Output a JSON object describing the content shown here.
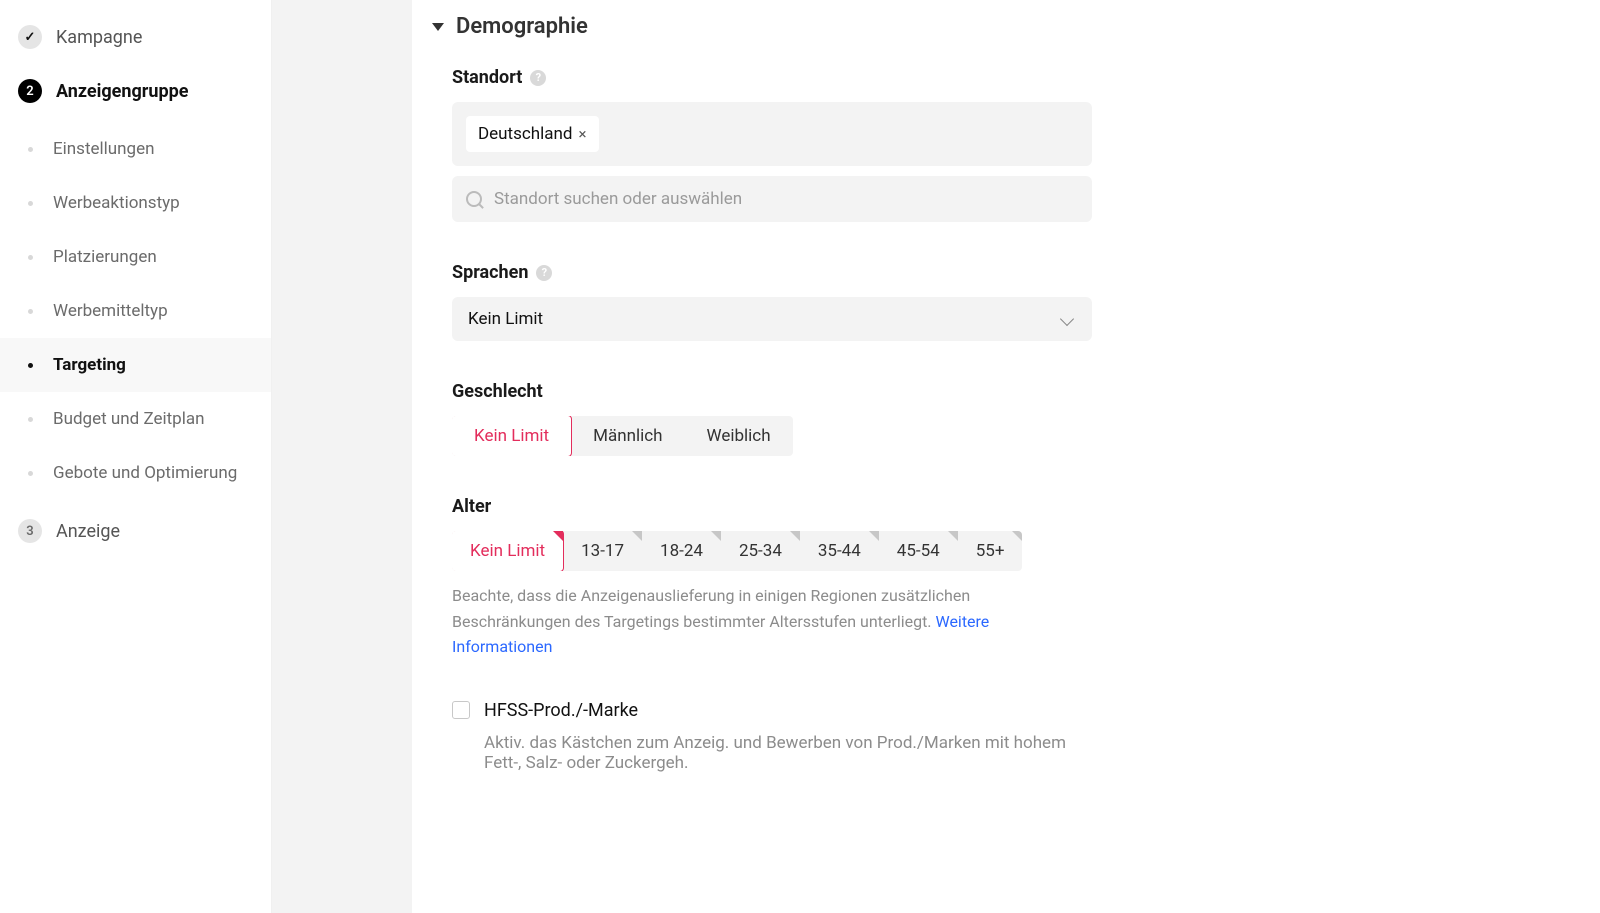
{
  "sidebar": {
    "steps": [
      {
        "label": "Kampagne",
        "state": "done"
      },
      {
        "label": "Anzeigengruppe",
        "state": "active",
        "items": [
          {
            "label": "Einstellungen",
            "current": false
          },
          {
            "label": "Werbeaktionstyp",
            "current": false
          },
          {
            "label": "Platzierungen",
            "current": false
          },
          {
            "label": "Werbemitteltyp",
            "current": false
          },
          {
            "label": "Targeting",
            "current": true
          },
          {
            "label": "Budget und Zeitplan",
            "current": false
          },
          {
            "label": "Gebote und Optimierung",
            "current": false
          }
        ]
      },
      {
        "label": "Anzeige",
        "state": "pending",
        "number": "3"
      }
    ]
  },
  "section": {
    "title": "Demographie"
  },
  "location": {
    "label": "Standort",
    "tokens": [
      "Deutschland"
    ],
    "search_placeholder": "Standort suchen oder auswählen"
  },
  "language": {
    "label": "Sprachen",
    "value": "Kein Limit"
  },
  "gender": {
    "label": "Geschlecht",
    "options": [
      "Kein Limit",
      "Männlich",
      "Weiblich"
    ],
    "selected_index": 0
  },
  "age": {
    "label": "Alter",
    "options": [
      "Kein Limit",
      "13-17",
      "18-24",
      "25-34",
      "35-44",
      "45-54",
      "55+"
    ],
    "selected_index": 0,
    "hint": "Beachte, dass die Anzeigenauslieferung in einigen Regionen zusätzlichen Beschränkungen des Targetings bestimmter Altersstufen unterliegt. ",
    "hint_link": "Weitere Informationen"
  },
  "hfss": {
    "label": "HFSS-Prod./-Marke",
    "checked": false,
    "desc": "Aktiv. das Kästchen zum Anzeig. und Bewerben von Prod./Marken mit hohem Fett-, Salz- oder Zuckergeh."
  }
}
